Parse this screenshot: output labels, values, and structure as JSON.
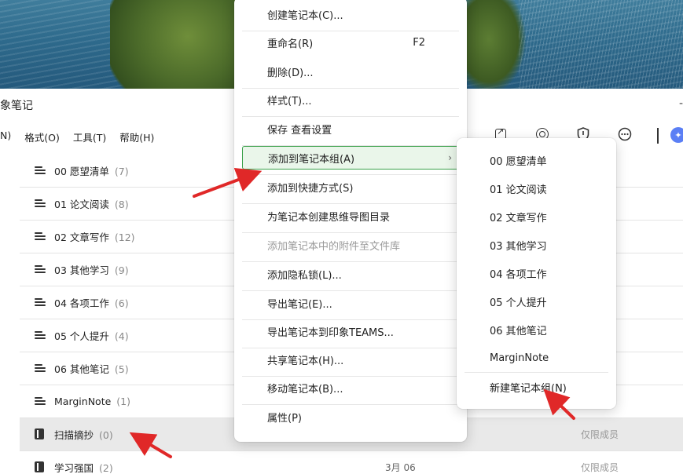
{
  "app": {
    "title": "象笔记",
    "title_right": "-"
  },
  "menubar": [
    "N)",
    "格式(O)",
    "工具(T)",
    "帮助(H)"
  ],
  "toolbar": {
    "icons": [
      "share-icon",
      "target-icon",
      "shield-icon",
      "more-icon",
      "ai-assistant-icon"
    ]
  },
  "notebooks": [
    {
      "name": "00 愿望清单",
      "count": "(7)",
      "icon": "stack",
      "date": "",
      "access": ""
    },
    {
      "name": "01 论文阅读",
      "count": "(8)",
      "icon": "stack",
      "date": "",
      "access": ""
    },
    {
      "name": "02 文章写作",
      "count": "(12)",
      "icon": "stack",
      "date": "",
      "access": ""
    },
    {
      "name": "03 其他学习",
      "count": "(9)",
      "icon": "stack",
      "date": "",
      "access": ""
    },
    {
      "name": "04 各项工作",
      "count": "(6)",
      "icon": "stack",
      "date": "",
      "access": ""
    },
    {
      "name": "05 个人提升",
      "count": "(4)",
      "icon": "stack",
      "date": "",
      "access": ""
    },
    {
      "name": "06 其他笔记",
      "count": "(5)",
      "icon": "stack",
      "date": "",
      "access": ""
    },
    {
      "name": "MarginNote",
      "count": "(1)",
      "icon": "stack",
      "date": "",
      "access": ""
    },
    {
      "name": "扫描摘抄",
      "count": "(0)",
      "icon": "book",
      "date": "",
      "access": "仅限成员",
      "selected": true
    },
    {
      "name": "学习强国",
      "count": "(2)",
      "icon": "book",
      "date": "3月 06",
      "access": "仅限成员"
    }
  ],
  "context_menu": {
    "items": [
      {
        "label": "创建笔记本(C)...",
        "shortcut": ""
      },
      {
        "label": "重命名(R)",
        "shortcut": "F2"
      },
      {
        "label": "删除(D)...",
        "shortcut": ""
      },
      {
        "label": "样式(T)...",
        "shortcut": ""
      },
      {
        "label": "保存 查看设置",
        "shortcut": ""
      },
      {
        "label": "添加到笔记本组(A)",
        "shortcut": "",
        "submenu": true,
        "active": true
      },
      {
        "label": "添加到快捷方式(S)",
        "shortcut": ""
      },
      {
        "label": "为笔记本创建思维导图目录",
        "shortcut": ""
      },
      {
        "label": "添加笔记本中的附件至文件库",
        "shortcut": "",
        "disabled": true
      },
      {
        "label": "添加隐私锁(L)...",
        "shortcut": ""
      },
      {
        "label": "导出笔记(E)...",
        "shortcut": ""
      },
      {
        "label": "导出笔记本到印象TEAMS...",
        "shortcut": ""
      },
      {
        "label": "共享笔记本(H)...",
        "shortcut": ""
      },
      {
        "label": "移动笔记本(B)...",
        "shortcut": ""
      },
      {
        "label": "属性(P)",
        "shortcut": ""
      }
    ]
  },
  "submenu": {
    "items": [
      "00 愿望清单",
      "01 论文阅读",
      "02 文章写作",
      "03 其他学习",
      "04 各项工作",
      "05 个人提升",
      "06 其他笔记",
      "MarginNote",
      "新建笔记本组(N)"
    ]
  },
  "colors": {
    "active_border": "#3aa14a",
    "active_bg": "#eaf6ea",
    "arrow": "#e02828",
    "ai_badge": "#5b7ff5"
  }
}
